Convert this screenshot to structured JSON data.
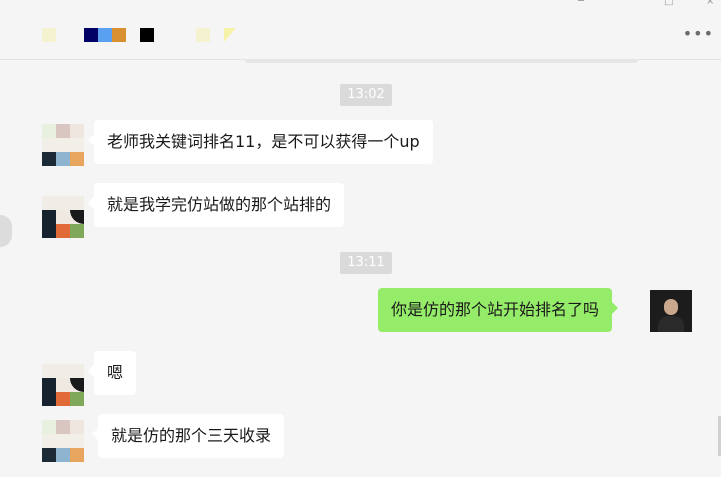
{
  "window": {
    "title_blocks": [
      {
        "color": "#f5f3cf"
      },
      {
        "color": "#000066"
      },
      {
        "color": "#5aa0f0"
      },
      {
        "color": "#d89030"
      },
      {
        "color": "#000000"
      },
      {
        "color": "#f5f3cf"
      },
      {
        "color": "#f5f3a8"
      }
    ],
    "more_icon": "more-horizontal-icon",
    "controls": [
      "pin-icon",
      "maximize-icon",
      "close-icon"
    ]
  },
  "messages": [
    {
      "type": "timestamp",
      "text": "13:02"
    },
    {
      "type": "incoming",
      "text": "老师我关键词排名11，是不可以获得一个up",
      "avatar": "contact-avatar-a"
    },
    {
      "type": "incoming",
      "text": "就是我学完仿站做的那个站排的",
      "avatar": "contact-avatar-b"
    },
    {
      "type": "timestamp",
      "text": "13:11"
    },
    {
      "type": "outgoing",
      "text": "你是仿的那个站开始排名了吗",
      "avatar": "my-avatar"
    },
    {
      "type": "incoming",
      "text": "嗯",
      "avatar": "contact-avatar-b"
    },
    {
      "type": "incoming",
      "text": "就是仿的那个三天收录",
      "avatar": "contact-avatar-a"
    }
  ]
}
